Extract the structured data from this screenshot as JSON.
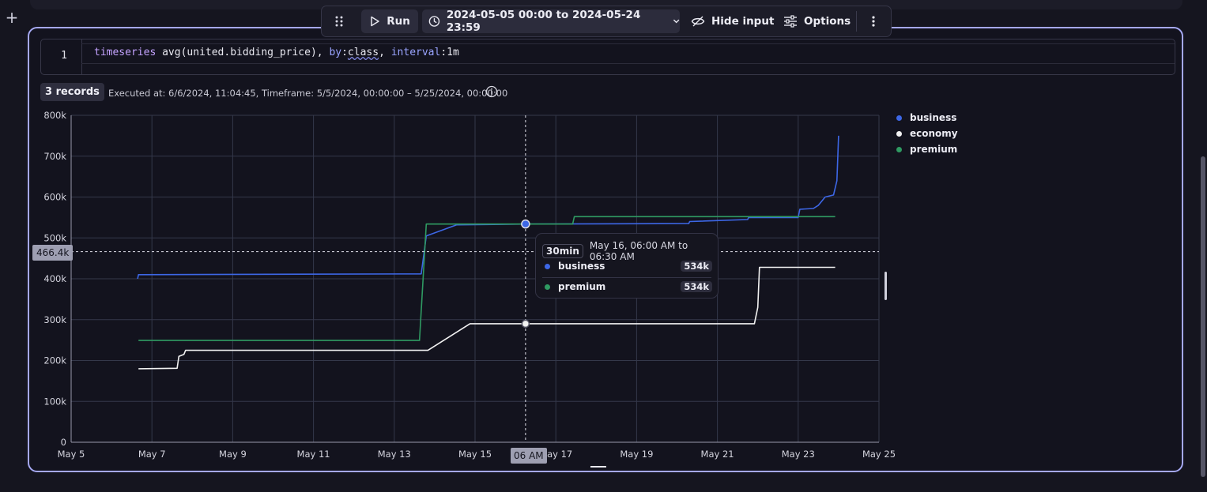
{
  "toolbar": {
    "run_label": "Run",
    "timeframe_label": "2024-05-05 00:00 to 2024-05-24 23:59",
    "hide_input_label": "Hide input",
    "options_label": "Options"
  },
  "editor": {
    "line_number": "1",
    "tokens": {
      "fn": "timeseries",
      "expr": " avg(united.bidding_price), ",
      "by_kw": "by",
      "colon1": ":",
      "class_kw": "class",
      "comma": ", ",
      "interval_kw": "interval",
      "colon2": ":",
      "interval_val": "1m"
    }
  },
  "result": {
    "records_label": "3 records",
    "executed_info": "Executed at: 6/6/2024, 11:04:45, Timeframe: 5/5/2024, 00:00:00 – 5/25/2024, 00:00:00"
  },
  "tooltip": {
    "interval_chip": "30min",
    "range": "May 16, 06:00 AM to 06:30 AM",
    "rows": [
      {
        "name": "business",
        "value": "534k"
      },
      {
        "name": "premium",
        "value": "534k"
      }
    ]
  },
  "crosshair": {
    "y_label": "466.4k",
    "x_label": "06 AM"
  },
  "colors": {
    "business": "#3d67e6",
    "economy": "#f2f2f2",
    "premium": "#2f9a62",
    "accent": "#a5a8f2"
  },
  "chart_data": {
    "type": "line",
    "x_ticks": [
      "May 5",
      "May 7",
      "May 9",
      "May 11",
      "May 13",
      "May 15",
      "May 17",
      "May 19",
      "May 21",
      "May 23",
      "May 25"
    ],
    "y_ticks": [
      "0",
      "100k",
      "200k",
      "300k",
      "400k",
      "500k",
      "600k",
      "700k",
      "800k"
    ],
    "xlim": [
      "2024-05-05",
      "2024-05-25"
    ],
    "ylim": [
      0,
      800000
    ],
    "grid": true,
    "legend_position": "right",
    "series": [
      {
        "name": "business",
        "points": [
          [
            "2024-05-06T15:30",
            400000
          ],
          [
            "2024-05-06T16:00",
            410000
          ],
          [
            "2024-05-13T16:00",
            412000
          ],
          [
            "2024-05-13T19:00",
            505000
          ],
          [
            "2024-05-14T13:00",
            532000
          ],
          [
            "2024-05-16T06:00",
            534000
          ],
          [
            "2024-05-20T07:00",
            535000
          ],
          [
            "2024-05-20T07:30",
            540000
          ],
          [
            "2024-05-21T18:00",
            545000
          ],
          [
            "2024-05-21T18:30",
            550000
          ],
          [
            "2024-05-23T00:00",
            550000
          ],
          [
            "2024-05-23T01:00",
            570000
          ],
          [
            "2024-05-23T09:00",
            572000
          ],
          [
            "2024-05-23T12:00",
            580000
          ],
          [
            "2024-05-23T16:00",
            600000
          ],
          [
            "2024-05-23T21:00",
            605000
          ],
          [
            "2024-05-23T23:00",
            640000
          ],
          [
            "2024-05-24T00:00",
            750000
          ]
        ]
      },
      {
        "name": "economy",
        "points": [
          [
            "2024-05-06T16:00",
            180000
          ],
          [
            "2024-05-07T15:00",
            181000
          ],
          [
            "2024-05-07T16:00",
            210000
          ],
          [
            "2024-05-07T19:00",
            215000
          ],
          [
            "2024-05-07T20:00",
            225000
          ],
          [
            "2024-05-13T20:00",
            225000
          ],
          [
            "2024-05-14T21:00",
            290000
          ],
          [
            "2024-05-16T06:00",
            290000
          ],
          [
            "2024-05-21T22:00",
            290000
          ],
          [
            "2024-05-22T00:00",
            330000
          ],
          [
            "2024-05-22T01:00",
            428000
          ],
          [
            "2024-05-23T22:00",
            428000
          ]
        ]
      },
      {
        "name": "premium",
        "points": [
          [
            "2024-05-06T16:00",
            249000
          ],
          [
            "2024-05-13T15:00",
            249000
          ],
          [
            "2024-05-13T19:00",
            534000
          ],
          [
            "2024-05-16T06:00",
            534000
          ],
          [
            "2024-05-17T10:00",
            534000
          ],
          [
            "2024-05-17T11:00",
            552000
          ],
          [
            "2024-05-23T22:00",
            552000
          ]
        ]
      }
    ]
  }
}
